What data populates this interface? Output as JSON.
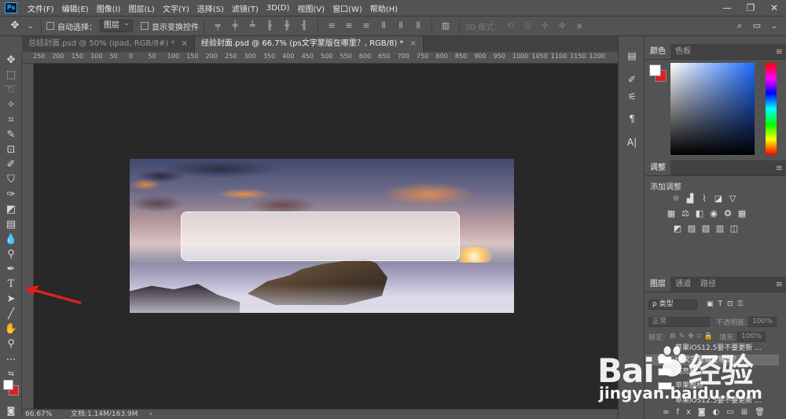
{
  "app": {
    "logo": "Ps"
  },
  "menu": [
    "文件(F)",
    "编辑(E)",
    "图像(I)",
    "图层(L)",
    "文字(Y)",
    "选择(S)",
    "滤镜(T)",
    "3D(D)",
    "视图(V)",
    "窗口(W)",
    "帮助(H)"
  ],
  "window_controls": {
    "minimize": "—",
    "restore": "❐",
    "close": "✕"
  },
  "options": {
    "auto_select_label": "自动选择：",
    "auto_select_value": "图层",
    "show_transform_label": "显示变换控件",
    "mode_3d_label": "3D 模式："
  },
  "tabs": [
    {
      "label": "总结封面.psd @ 50% (ipad, RGB/8#) *",
      "close": "×"
    },
    {
      "label": "经验封面.psd @ 66.7% (ps文字蒙版在哪里？, RGB/8) *",
      "close": "×"
    }
  ],
  "ruler_labels": [
    "250",
    "200",
    "150",
    "100",
    "50",
    "0",
    "50",
    "100",
    "150",
    "200",
    "250",
    "300",
    "350",
    "400",
    "450",
    "500",
    "550",
    "600",
    "650",
    "700",
    "750",
    "800",
    "850",
    "900",
    "950",
    "1000",
    "1050",
    "1100",
    "1150",
    "1200"
  ],
  "status": {
    "zoom": "66.67%",
    "doc_info": "文档:1.14M/163.9M",
    "arrow": "›"
  },
  "panels": {
    "color_tabs": [
      "颜色",
      "色板"
    ],
    "adjust_tab": "调整",
    "adjust_title": "添加调整",
    "layer_tabs": [
      "图层",
      "通道",
      "路径"
    ],
    "filter_label": "ρ 类型",
    "blend_mode": "正常",
    "opacity_label": "不透明度:",
    "opacity_value": "100%",
    "lock_label": "锁定:",
    "fill_label": "填充:",
    "fill_value": "100%",
    "layers": [
      "苹果iOS12.5要不要更新 ...",
      "ps文字蒙版在哪里？",
      "高亮框",
      "苹果图标",
      "苹果iOS12.5要不要更新 ..."
    ],
    "layer_footer_icons": [
      "link-icon",
      "fx-icon",
      "mask-icon",
      "adjustment-icon",
      "folder-icon",
      "new-layer-icon",
      "trash-icon"
    ]
  },
  "watermark": {
    "brand": "Bai",
    "brand_suffix": "经验",
    "url": "jingyan.baidu.com"
  },
  "colors": {
    "foreground": "#ffffff",
    "background": "#e02020",
    "annotation_arrow": "#e02020"
  }
}
